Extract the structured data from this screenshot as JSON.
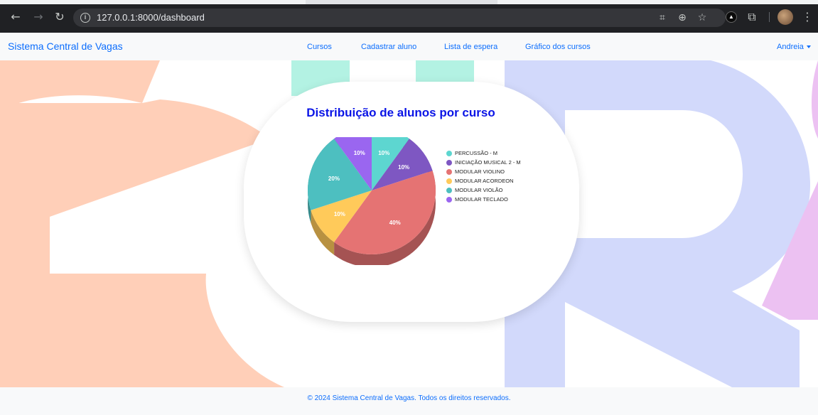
{
  "browser": {
    "url": "127.0.0.1:8000/dashboard",
    "back_icon": "arrow-left-icon",
    "forward_icon": "arrow-right-icon",
    "reload_icon": "reload-icon"
  },
  "navbar": {
    "brand": "Sistema Central de Vagas",
    "links": [
      "Cursos",
      "Cadastrar aluno",
      "Lista de espera",
      "Gráfico dos cursos"
    ],
    "user": "Andreia"
  },
  "chart_data": {
    "type": "pie",
    "title": "Distribuição de alunos por curso",
    "categories": [
      "PERCUSSÃO - M",
      "INICIAÇÃO MUSICAL 2 - M",
      "MODULAR VIOLINO",
      "MODULAR ACORDEON",
      "MODULAR VIOLÃO",
      "MODULAR TECLADO"
    ],
    "values": [
      10,
      10,
      40,
      10,
      20,
      10
    ],
    "value_labels": [
      "10%",
      "10%",
      "40%",
      "10%",
      "20%",
      "10%"
    ],
    "colors": [
      "#5dd6d0",
      "#7e57c2",
      "#e57373",
      "#ffca5a",
      "#4dbfc0",
      "#9a66f0"
    ],
    "legend_position": "right",
    "style": "3d"
  },
  "footer": {
    "text": "© 2024 Sistema Central de Vagas. Todos os direitos reservados."
  }
}
